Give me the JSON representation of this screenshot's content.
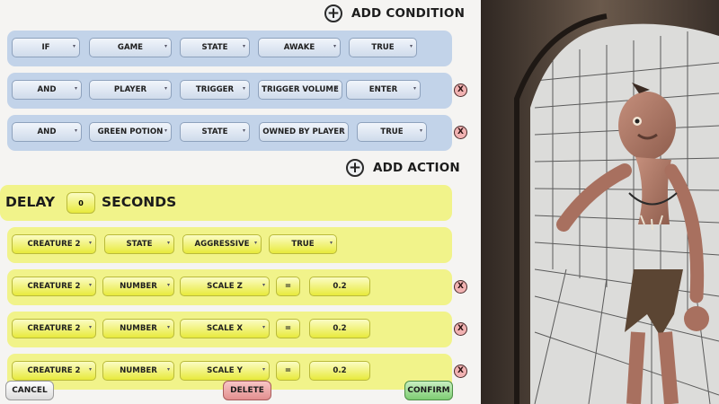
{
  "header": {
    "add_condition_label": "ADD CONDITION",
    "add_action_label": "ADD ACTION"
  },
  "conditions": [
    {
      "fields": [
        "IF",
        "GAME",
        "STATE",
        "AWAKE",
        "TRUE"
      ]
    },
    {
      "fields": [
        "AND",
        "PLAYER",
        "TRIGGER",
        "TRIGGER VOLUME",
        "ENTER"
      ]
    },
    {
      "fields": [
        "AND",
        "GREEN POTION",
        "STATE",
        "OWNED BY PLAYER",
        "TRUE"
      ]
    }
  ],
  "delay": {
    "label": "DELAY",
    "value": "0",
    "unit_label": "SECONDS"
  },
  "actions": [
    {
      "fields": [
        "CREATURE 2",
        "STATE",
        "AGGRESSIVE",
        "TRUE"
      ]
    },
    {
      "fields": [
        "CREATURE 2",
        "NUMBER",
        "SCALE Z",
        "=",
        "0.2"
      ]
    },
    {
      "fields": [
        "CREATURE 2",
        "NUMBER",
        "SCALE X",
        "=",
        "0.2"
      ]
    },
    {
      "fields": [
        "CREATURE 2",
        "NUMBER",
        "SCALE Y",
        "=",
        "0.2"
      ]
    }
  ],
  "footer": {
    "cancel_label": "CANCEL",
    "delete_label": "DELETE",
    "confirm_label": "CONFIRM"
  },
  "remove_glyph": "X",
  "colors": {
    "condition_row": "#c2d3e9",
    "action_row": "#f1f38a",
    "confirm": "#7ecd73",
    "delete": "#e28f8f"
  }
}
